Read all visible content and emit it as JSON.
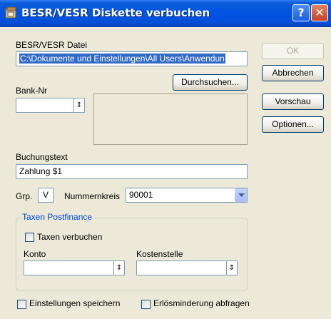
{
  "window": {
    "title": "BESR/VESR Diskette verbuchen",
    "help_glyph": "?",
    "close_glyph": "✕"
  },
  "form": {
    "datei_label": "BESR/VESR Datei",
    "datei_value": "C:\\Dokumente und Einstellungen\\All Users\\Anwendun",
    "durchsuchen_label": "Durchsuchen...",
    "bank_label": "Bank-Nr",
    "bank_value": "",
    "buchungstext_label": "Buchungstext",
    "buchungstext_value": "Zahlung $1",
    "grp_label": "Grp.",
    "grp_value": "V",
    "nummernkreis_label": "Nummernkreis",
    "nummernkreis_value": "90001"
  },
  "taxen": {
    "legend": "Taxen Postfinance",
    "verbuchen_label": "Taxen verbuchen",
    "konto_label": "Konto",
    "konto_value": "",
    "kostenstelle_label": "Kostenstelle",
    "kostenstelle_value": ""
  },
  "bottom": {
    "einstellungen_label": "Einstellungen speichern",
    "erloes_label": "Erlösminderung abfragen"
  },
  "buttons": {
    "ok": "OK",
    "abbrechen": "Abbrechen",
    "vorschau": "Vorschau",
    "optionen": "Optionen..."
  },
  "spin_glyph": "⇕"
}
